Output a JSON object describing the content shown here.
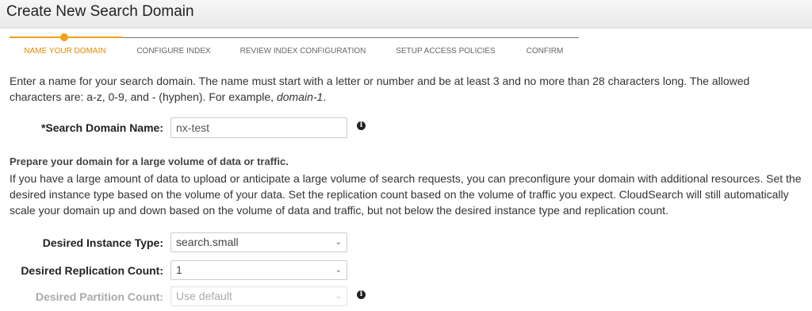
{
  "header": {
    "title": "Create New Search Domain"
  },
  "wizard": {
    "steps": [
      {
        "label": "NAME YOUR DOMAIN",
        "active": true
      },
      {
        "label": "CONFIGURE INDEX",
        "active": false
      },
      {
        "label": "REVIEW INDEX CONFIGURATION",
        "active": false
      },
      {
        "label": "SETUP ACCESS POLICIES",
        "active": false
      },
      {
        "label": "CONFIRM",
        "active": false
      }
    ],
    "accent_color": "#f0a11c"
  },
  "intro": {
    "text": "Enter a name for your search domain. The name must start with a letter or number and be at least 3 and no more than 28 characters long. The allowed characters are: a-z, 0-9, and - (hyphen). For example, ",
    "example": "domain-1",
    "suffix": "."
  },
  "domain_name": {
    "label": "*Search Domain Name:",
    "value": "nx-test",
    "info_icon": "info-icon"
  },
  "capacity": {
    "heading": "Prepare your domain for a large volume of data or traffic.",
    "description": "If you have a large amount of data to upload or anticipate a large volume of search requests, you can preconfigure your domain with additional resources. Set the desired instance type based on the volume of your data. Set the replication count based on the volume of traffic you expect. CloudSearch will still automatically scale your domain up and down based on the volume of data and traffic, but not below the desired instance type and replication count."
  },
  "instance_type": {
    "label": "Desired Instance Type:",
    "value": "search.small"
  },
  "replication_count": {
    "label": "Desired Replication Count:",
    "value": "1"
  },
  "partition_count": {
    "label": "Desired Partition Count:",
    "value": "Use default",
    "disabled": true,
    "info_icon": "info-icon"
  }
}
